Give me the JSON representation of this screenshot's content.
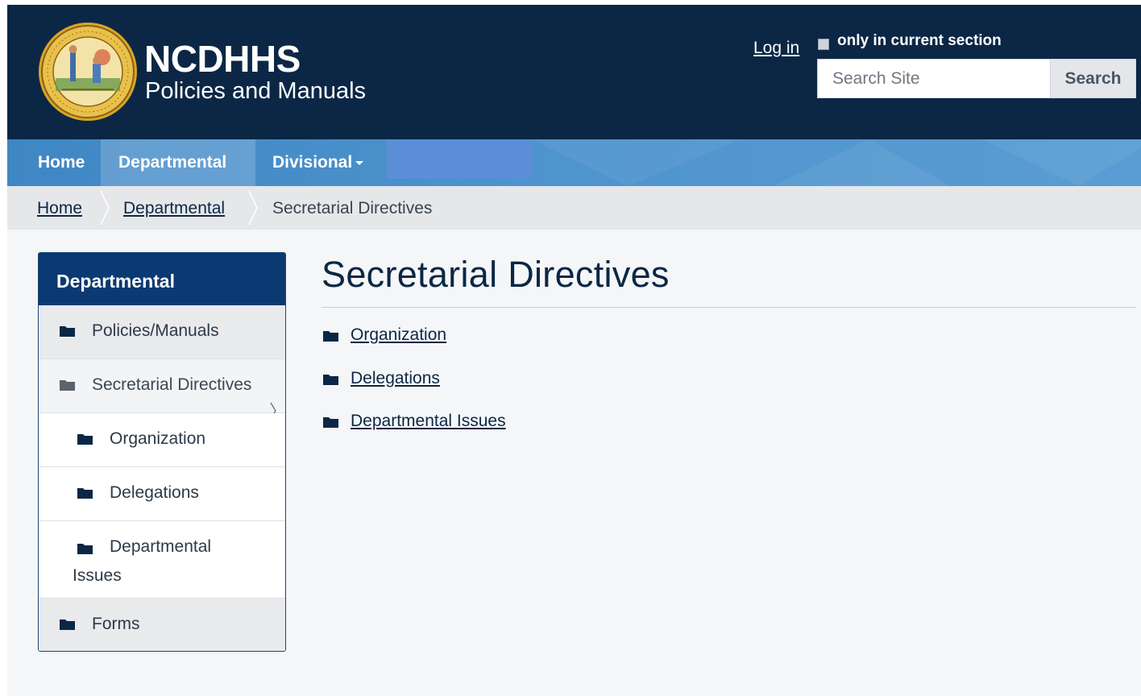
{
  "header": {
    "brand_name": "NCDHHS",
    "brand_sub": "Policies and Manuals",
    "login_label": "Log in",
    "section_only_label": "only in current section",
    "search_placeholder": "Search Site",
    "search_button_label": "Search",
    "bg_color": "#0b2745"
  },
  "navbar": {
    "home_label": "Home",
    "departmental_label": "Departmental",
    "divisional_label": "Divisional",
    "accent_color": "#4d93cd"
  },
  "breadcrumb": {
    "home": "Home",
    "departmental": "Departmental",
    "current": "Secretarial Directives"
  },
  "sidebar": {
    "title": "Departmental",
    "items": [
      {
        "label": "Policies/Manuals",
        "icon": "folder-icon",
        "level": 1
      },
      {
        "label": "Secretarial Directives",
        "icon": "folder-open-icon",
        "level": 1,
        "active": true
      },
      {
        "label": "Organization",
        "icon": "folder-icon",
        "level": 2
      },
      {
        "label": "Delegations",
        "icon": "folder-icon",
        "level": 2
      },
      {
        "label": "Departmental Issues",
        "icon": "folder-icon",
        "level": 2
      },
      {
        "label": "Forms",
        "icon": "folder-icon",
        "level": 1
      }
    ]
  },
  "main": {
    "title": "Secretarial Directives",
    "links": [
      {
        "label": "Organization",
        "icon": "folder-icon"
      },
      {
        "label": "Delegations",
        "icon": "folder-icon"
      },
      {
        "label": "Departmental Issues",
        "icon": "folder-icon"
      }
    ]
  }
}
